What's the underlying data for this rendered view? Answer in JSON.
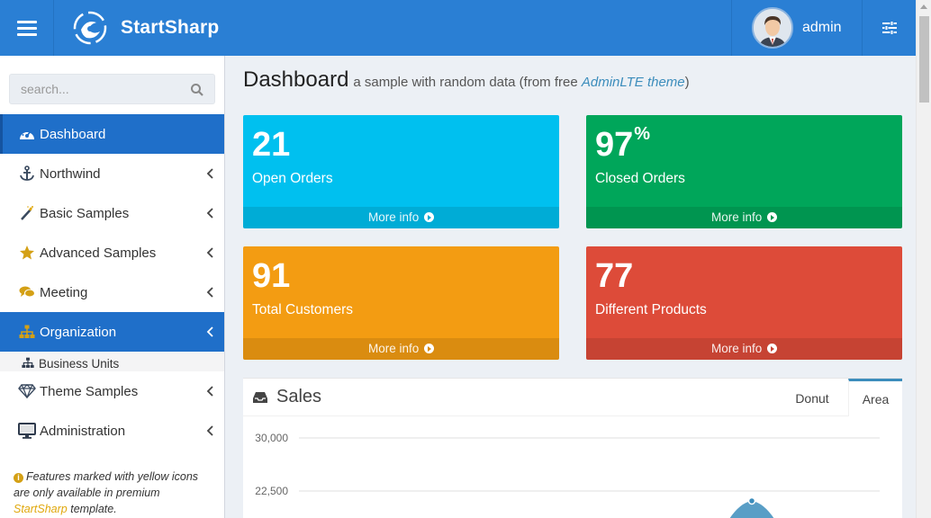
{
  "header": {
    "app_name": "StartSharp",
    "user_name": "admin"
  },
  "search": {
    "placeholder": "search..."
  },
  "sidebar": {
    "items": [
      {
        "label": "Dashboard",
        "icon": "dashboard-icon"
      },
      {
        "label": "Northwind",
        "icon": "anchor-icon"
      },
      {
        "label": "Basic Samples",
        "icon": "magic-wand-icon"
      },
      {
        "label": "Advanced Samples",
        "icon": "star-icon"
      },
      {
        "label": "Meeting",
        "icon": "comments-icon"
      },
      {
        "label": "Organization",
        "icon": "sitemap-icon"
      },
      {
        "label": "Theme Samples",
        "icon": "diamond-icon"
      },
      {
        "label": "Administration",
        "icon": "desktop-icon"
      }
    ],
    "subitem": {
      "label": "Business Units",
      "icon": "sitemap-icon"
    },
    "note": {
      "text_1": "Features marked with yellow icons are only available in premium",
      "link": "StartSharp",
      "text_2": "template."
    }
  },
  "page": {
    "title": "Dashboard",
    "subtitle_prefix": "a sample with random data (from free",
    "subtitle_link": "AdminLTE theme",
    "subtitle_suffix": ")"
  },
  "boxes": [
    {
      "value": "21",
      "suffix": "",
      "label": "Open Orders",
      "footer": "More info",
      "color": "#00c0ef"
    },
    {
      "value": "97",
      "suffix": "%",
      "label": "Closed Orders",
      "footer": "More info",
      "color": "#00a65a"
    },
    {
      "value": "91",
      "suffix": "",
      "label": "Total Customers",
      "footer": "More info",
      "color": "#f39c12"
    },
    {
      "value": "77",
      "suffix": "",
      "label": "Different Products",
      "footer": "More info",
      "color": "#dd4b39"
    }
  ],
  "sales": {
    "title": "Sales",
    "tabs": [
      "Donut",
      "Area"
    ],
    "active_tab": "Area"
  },
  "chart_data": {
    "type": "area",
    "y_ticks": [
      "30,000",
      "22,500"
    ],
    "y_tick_values": [
      30000,
      22500
    ],
    "series_color": "#3c8dbc"
  }
}
